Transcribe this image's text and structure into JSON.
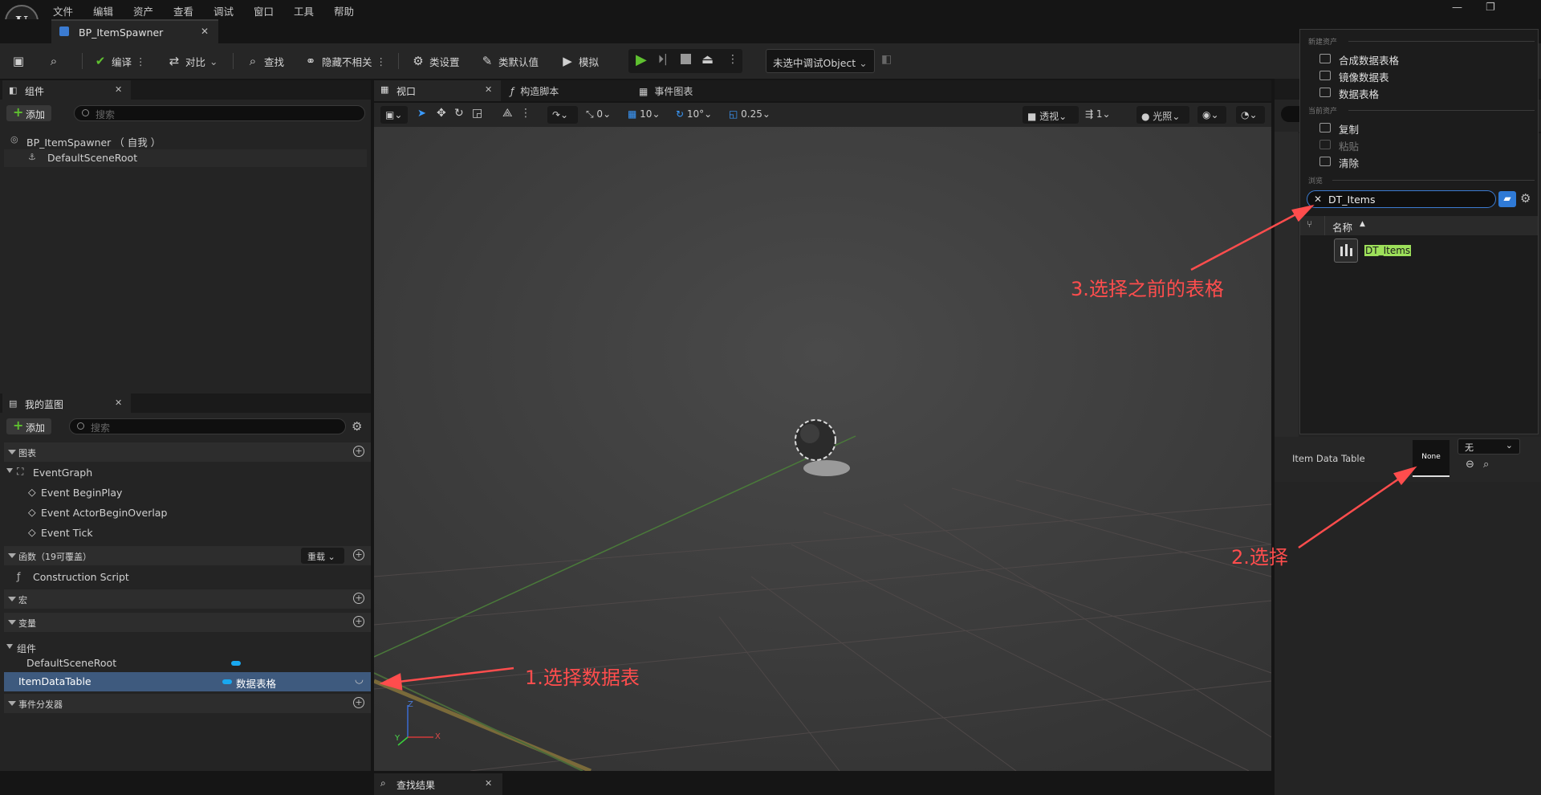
{
  "menu": [
    "文件",
    "编辑",
    "资产",
    "查看",
    "调试",
    "窗口",
    "工具",
    "帮助"
  ],
  "document_tab": "BP_ItemSpawner",
  "toolbar": {
    "compile": "编译",
    "diff": "对比",
    "find": "查找",
    "hide_unrelated": "隐藏不相关",
    "class_settings": "类设置",
    "class_defaults": "类默认值",
    "simulate": "模拟",
    "debug_object": "未选中调试Object"
  },
  "components_panel": {
    "tab": "组件",
    "add": "添加",
    "search_placeholder": "搜索",
    "root": "BP_ItemSpawner （ 自我 ）",
    "child": "DefaultSceneRoot"
  },
  "viewport_tabs": [
    "视口",
    "构造脚本",
    "事件图表"
  ],
  "viewport_toolbar": {
    "snap": "0",
    "grid": "10",
    "rot": "10°",
    "scale": "0.25",
    "perspective": "透视",
    "speed": "1",
    "lit": "光照"
  },
  "my_blueprint": {
    "tab": "我的蓝图",
    "add": "添加",
    "search_placeholder": "搜索",
    "graphs_header": "图表",
    "event_graph": "EventGraph",
    "events": [
      "Event BeginPlay",
      "Event ActorBeginOverlap",
      "Event Tick"
    ],
    "functions_header": "函数（19可覆盖）",
    "override": "重载",
    "construction_script": "Construction Script",
    "macros_header": "宏",
    "variables_header": "变量",
    "components_header": "组件",
    "var_default_root": "DefaultSceneRoot",
    "selected_var": "ItemDataTable",
    "selected_var_type": "数据表格",
    "dispatchers_header": "事件分发器"
  },
  "bottom_tab": "查找结果",
  "details": {
    "property_label": "Item Data Table",
    "thumb_text": "None",
    "combo_value": "无"
  },
  "popup": {
    "header_new": "新建资产",
    "new_items": [
      "合成数据表格",
      "镜像数据表",
      "数据表格"
    ],
    "header_current": "当前资产",
    "copy": "复制",
    "paste": "粘贴",
    "clear": "清除",
    "header_browse": "浏览",
    "search_value": "DT_Items",
    "column_name": "名称",
    "result": "DT_Items"
  },
  "annotations": {
    "a1": "1.选择数据表",
    "a2": "2.选择",
    "a3": "3.选择之前的表格"
  },
  "colors": {
    "accent": "#3b7bd1",
    "annotation": "#ff4d4d",
    "play": "#5fc030",
    "highlight": "#9de05a"
  }
}
